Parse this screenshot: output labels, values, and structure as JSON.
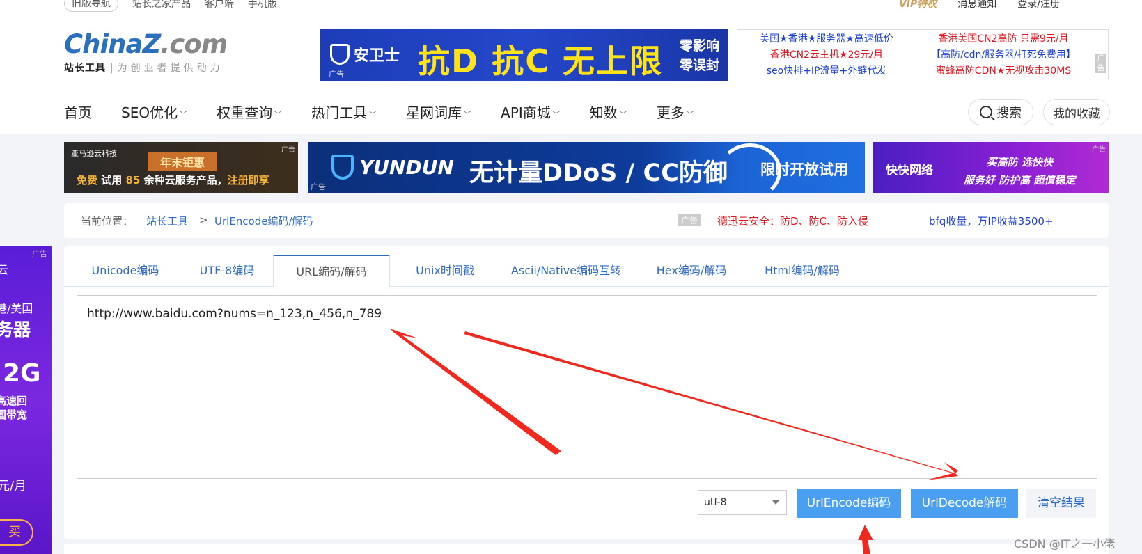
{
  "topbar": {
    "old_nav": "旧版导航",
    "products": "站长之家产品",
    "client": "客户端",
    "mobile": "手机版",
    "vip": "VIP特权",
    "notify": "消息通知",
    "login": "登录/注册"
  },
  "logo": {
    "word_a": "China",
    "word_z": "Z",
    "word_b": ".com",
    "sub_bold": "站长工具",
    "sub_slogan": "为创业者提供动力"
  },
  "top_ad": {
    "brand": "安卫士",
    "headline": "抗D 抗C 无上限",
    "side_line1": "零影响",
    "side_line2": "零误封",
    "tag": "广告"
  },
  "text_ad": {
    "left": [
      "美国★香港★服务器★高速低价",
      "香港CN2云主机★29元/月",
      "seo快排+IP流量+外链代发"
    ],
    "right": [
      "香港美国CN2高防 只需9元/月",
      "【高防/cdn/服务器/打死免费用】",
      "蜜蜂高防CDN★无视攻击30MS"
    ],
    "tag": "广告"
  },
  "nav": {
    "items": [
      "首页",
      "SEO优化",
      "权重查询",
      "热门工具",
      "星网词库",
      "API商城",
      "知数",
      "更多"
    ],
    "search": "搜索",
    "favorites": "我的收藏"
  },
  "banner_ads": {
    "ad1": {
      "company": "亚马逊云科技",
      "promo": "年末钜惠",
      "line_a": "免费",
      "line_b": " 试用 ",
      "line_c": "85",
      "line_d": " 余种云服务产品，",
      "line_e": "注册即享",
      "tag": "广告"
    },
    "ad2": {
      "brand": "YUNDUN",
      "headline": "无计量DDoS / CC防御",
      "cta": "限时开放试用",
      "tag": "广告"
    },
    "ad3": {
      "brand": "快快网络",
      "slogan1": "买高防 选快快",
      "slogan2": "服务好 防护高 超值稳定",
      "tag": "广告"
    }
  },
  "breadcrumb": {
    "label": "当前位置：",
    "home": "站长工具",
    "sep": ">",
    "current": "UrlEncode编码/解码",
    "ad_tag": "广告",
    "ad_red": "德迅云安全：防D、防C、防入侵",
    "ad_blue": "bfq收量，万IP收益3500+"
  },
  "side_ad": {
    "tag": "广告",
    "l1": "云",
    "l2": "港/美国",
    "l3": "务器",
    "l4": "2G",
    "l5a": "高速回",
    "l5b": "国带宽",
    "l6": "元/月",
    "buy": "买"
  },
  "tabs": [
    "Unicode编码",
    "UTF-8编码",
    "URL编码/解码",
    "Unix时间戳",
    "Ascii/Native编码互转",
    "Hex编码/解码",
    "Html编码/解码"
  ],
  "active_tab": "URL编码/解码",
  "editor": {
    "value": "http://www.baidu.com?nums=n_123,n_456,n_789"
  },
  "controls": {
    "charset": "utf-8",
    "encode": "UrlEncode编码",
    "decode": "UrlDecode解码",
    "clear": "清空结果"
  },
  "watermark": "CSDN @IT之一小佬",
  "colors": {
    "link": "#2f6bc3",
    "button": "#4a9ff0",
    "annotation_arrow": "#f0281e"
  }
}
